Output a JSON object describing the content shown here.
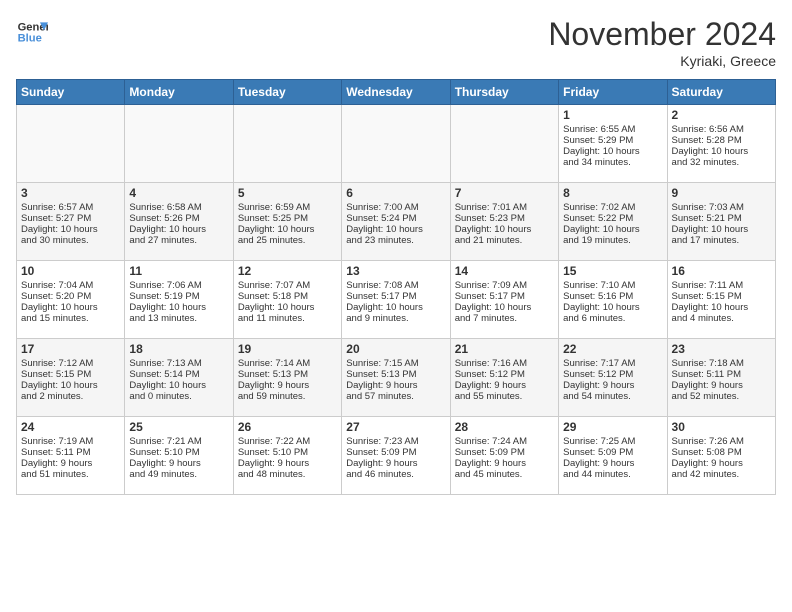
{
  "header": {
    "logo_line1": "General",
    "logo_line2": "Blue",
    "month": "November 2024",
    "location": "Kyriaki, Greece"
  },
  "weekdays": [
    "Sunday",
    "Monday",
    "Tuesday",
    "Wednesday",
    "Thursday",
    "Friday",
    "Saturday"
  ],
  "weeks": [
    [
      {
        "day": "",
        "text": ""
      },
      {
        "day": "",
        "text": ""
      },
      {
        "day": "",
        "text": ""
      },
      {
        "day": "",
        "text": ""
      },
      {
        "day": "",
        "text": ""
      },
      {
        "day": "1",
        "text": "Sunrise: 6:55 AM\nSunset: 5:29 PM\nDaylight: 10 hours\nand 34 minutes."
      },
      {
        "day": "2",
        "text": "Sunrise: 6:56 AM\nSunset: 5:28 PM\nDaylight: 10 hours\nand 32 minutes."
      }
    ],
    [
      {
        "day": "3",
        "text": "Sunrise: 6:57 AM\nSunset: 5:27 PM\nDaylight: 10 hours\nand 30 minutes."
      },
      {
        "day": "4",
        "text": "Sunrise: 6:58 AM\nSunset: 5:26 PM\nDaylight: 10 hours\nand 27 minutes."
      },
      {
        "day": "5",
        "text": "Sunrise: 6:59 AM\nSunset: 5:25 PM\nDaylight: 10 hours\nand 25 minutes."
      },
      {
        "day": "6",
        "text": "Sunrise: 7:00 AM\nSunset: 5:24 PM\nDaylight: 10 hours\nand 23 minutes."
      },
      {
        "day": "7",
        "text": "Sunrise: 7:01 AM\nSunset: 5:23 PM\nDaylight: 10 hours\nand 21 minutes."
      },
      {
        "day": "8",
        "text": "Sunrise: 7:02 AM\nSunset: 5:22 PM\nDaylight: 10 hours\nand 19 minutes."
      },
      {
        "day": "9",
        "text": "Sunrise: 7:03 AM\nSunset: 5:21 PM\nDaylight: 10 hours\nand 17 minutes."
      }
    ],
    [
      {
        "day": "10",
        "text": "Sunrise: 7:04 AM\nSunset: 5:20 PM\nDaylight: 10 hours\nand 15 minutes."
      },
      {
        "day": "11",
        "text": "Sunrise: 7:06 AM\nSunset: 5:19 PM\nDaylight: 10 hours\nand 13 minutes."
      },
      {
        "day": "12",
        "text": "Sunrise: 7:07 AM\nSunset: 5:18 PM\nDaylight: 10 hours\nand 11 minutes."
      },
      {
        "day": "13",
        "text": "Sunrise: 7:08 AM\nSunset: 5:17 PM\nDaylight: 10 hours\nand 9 minutes."
      },
      {
        "day": "14",
        "text": "Sunrise: 7:09 AM\nSunset: 5:17 PM\nDaylight: 10 hours\nand 7 minutes."
      },
      {
        "day": "15",
        "text": "Sunrise: 7:10 AM\nSunset: 5:16 PM\nDaylight: 10 hours\nand 6 minutes."
      },
      {
        "day": "16",
        "text": "Sunrise: 7:11 AM\nSunset: 5:15 PM\nDaylight: 10 hours\nand 4 minutes."
      }
    ],
    [
      {
        "day": "17",
        "text": "Sunrise: 7:12 AM\nSunset: 5:15 PM\nDaylight: 10 hours\nand 2 minutes."
      },
      {
        "day": "18",
        "text": "Sunrise: 7:13 AM\nSunset: 5:14 PM\nDaylight: 10 hours\nand 0 minutes."
      },
      {
        "day": "19",
        "text": "Sunrise: 7:14 AM\nSunset: 5:13 PM\nDaylight: 9 hours\nand 59 minutes."
      },
      {
        "day": "20",
        "text": "Sunrise: 7:15 AM\nSunset: 5:13 PM\nDaylight: 9 hours\nand 57 minutes."
      },
      {
        "day": "21",
        "text": "Sunrise: 7:16 AM\nSunset: 5:12 PM\nDaylight: 9 hours\nand 55 minutes."
      },
      {
        "day": "22",
        "text": "Sunrise: 7:17 AM\nSunset: 5:12 PM\nDaylight: 9 hours\nand 54 minutes."
      },
      {
        "day": "23",
        "text": "Sunrise: 7:18 AM\nSunset: 5:11 PM\nDaylight: 9 hours\nand 52 minutes."
      }
    ],
    [
      {
        "day": "24",
        "text": "Sunrise: 7:19 AM\nSunset: 5:11 PM\nDaylight: 9 hours\nand 51 minutes."
      },
      {
        "day": "25",
        "text": "Sunrise: 7:21 AM\nSunset: 5:10 PM\nDaylight: 9 hours\nand 49 minutes."
      },
      {
        "day": "26",
        "text": "Sunrise: 7:22 AM\nSunset: 5:10 PM\nDaylight: 9 hours\nand 48 minutes."
      },
      {
        "day": "27",
        "text": "Sunrise: 7:23 AM\nSunset: 5:09 PM\nDaylight: 9 hours\nand 46 minutes."
      },
      {
        "day": "28",
        "text": "Sunrise: 7:24 AM\nSunset: 5:09 PM\nDaylight: 9 hours\nand 45 minutes."
      },
      {
        "day": "29",
        "text": "Sunrise: 7:25 AM\nSunset: 5:09 PM\nDaylight: 9 hours\nand 44 minutes."
      },
      {
        "day": "30",
        "text": "Sunrise: 7:26 AM\nSunset: 5:08 PM\nDaylight: 9 hours\nand 42 minutes."
      }
    ]
  ]
}
